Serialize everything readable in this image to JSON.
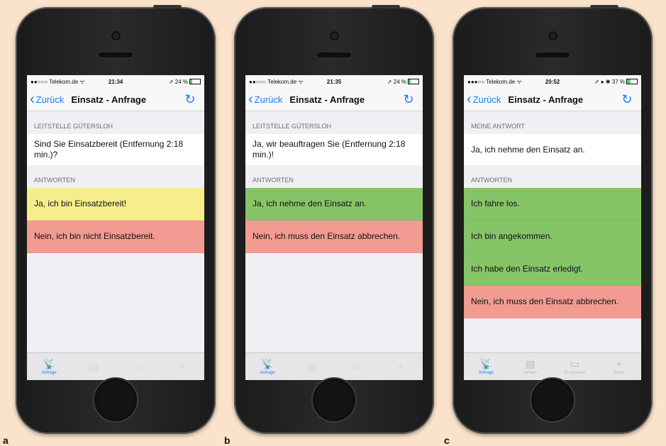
{
  "phones": [
    {
      "label": "a",
      "status": {
        "carrier": "●●○○○ Telekom.de ᯤ",
        "time": "21:34",
        "right": "➚ 24 %"
      },
      "nav": {
        "back": "Zurück",
        "title": "Einsatz - Anfrage"
      },
      "section1": "LEITSTELLE GÜTERSLOH",
      "question": "Sind Sie Einsatzbereit (Entfernung 2:18 min.)?",
      "section2": "ANTWORTEN",
      "answers": [
        "Ja, ich bin Einsatzbereit!",
        "Nein, ich bin nicht Einsatzbereit."
      ],
      "tabs": [
        "Anfrage"
      ]
    },
    {
      "label": "b",
      "status": {
        "carrier": "●●○○○ Telekom.de ᯤ",
        "time": "21:35",
        "right": "➚ 24 %"
      },
      "nav": {
        "back": "Zurück",
        "title": "Einsatz - Anfrage"
      },
      "section1": "LEITSTELLE GÜTERSLOH",
      "question": "Ja, wir beauftragen Sie (Entfernung 2:18 min.)!",
      "section2": "ANTWORTEN",
      "answers": [
        "Ja, ich nehme den Einsatz an.",
        "Nein, ich muss den Einsatz abbrechen."
      ],
      "tabs": [
        "Anfrage"
      ]
    },
    {
      "label": "c",
      "status": {
        "carrier": "●●●○○ Telekom.de ᯤ",
        "time": "20:52",
        "right": "➚ ● ✱ 37 %"
      },
      "nav": {
        "back": "Zurück",
        "title": "Einsatz - Anfrage"
      },
      "section1": "MEINE ANTWORT",
      "question": "Ja, ich nehme den Einsatz an.",
      "section2": "ANTWORTEN",
      "answers": [
        "Ich fahre los.",
        "Ich bin angekommen.",
        "Ich habe den Einsatz erledigt.",
        "Nein, ich muss den Einsatz abbrechen."
      ],
      "tabs": [
        "Anfrage",
        "Details",
        "ID-Ausweis",
        "Karte"
      ]
    }
  ],
  "colors": {
    "accent": "#1f7cf6",
    "yellow": "#f6ee8b",
    "green": "#86c468",
    "red": "#f19b92"
  }
}
